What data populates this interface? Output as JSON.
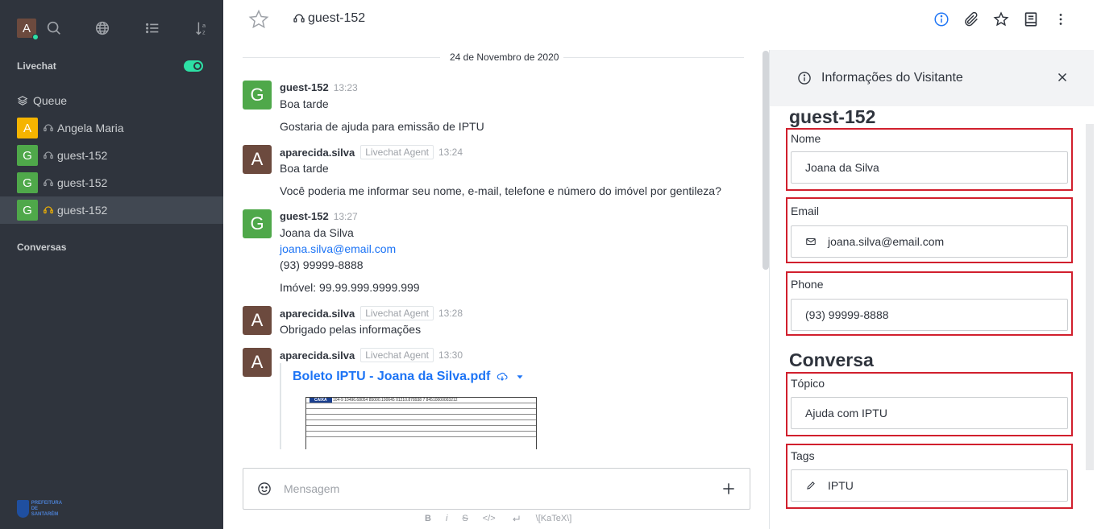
{
  "sidebar": {
    "user_initial": "A",
    "livechat_label": "Livechat",
    "queue_label": "Queue",
    "rooms": [
      {
        "initial": "A",
        "name": "Angela Maria",
        "color": "#f5b400",
        "active": false
      },
      {
        "initial": "G",
        "name": "guest-152",
        "color": "#4fa84a",
        "active": false
      },
      {
        "initial": "G",
        "name": "guest-152",
        "color": "#4fa84a",
        "active": false
      },
      {
        "initial": "G",
        "name": "guest-152",
        "color": "#4fa84a",
        "active": true
      }
    ],
    "conversas_label": "Conversas",
    "logo_text_line1": "PREFEITURA DE",
    "logo_text_line2": "SANTARÉM"
  },
  "header": {
    "room_name": "guest-152"
  },
  "messages": {
    "date": "24 de Novembro de 2020",
    "items": [
      {
        "initial": "G",
        "color": "#4fa84a",
        "user": "guest-152",
        "role": "",
        "time": "13:23",
        "lines": [
          "Boa tarde",
          "Gostaria de ajuda para emissão de IPTU"
        ]
      },
      {
        "initial": "A",
        "color": "#6c4a3e",
        "user": "aparecida.silva",
        "role": "Livechat Agent",
        "time": "13:24",
        "lines": [
          "Boa tarde",
          "Você poderia me informar seu nome, e-mail, telefone e número do imóvel por gentileza?"
        ]
      },
      {
        "initial": "G",
        "color": "#4fa84a",
        "user": "guest-152",
        "role": "",
        "time": "13:27",
        "lines": [
          "Joana da Silva",
          "joana.silva@email.com",
          "(93) 99999-8888",
          "Imóvel: 99.99.999.9999.999"
        ]
      },
      {
        "initial": "A",
        "color": "#6c4a3e",
        "user": "aparecida.silva",
        "role": "Livechat Agent",
        "time": "13:28",
        "lines": [
          "Obrigado pelas informações"
        ]
      },
      {
        "initial": "A",
        "color": "#6c4a3e",
        "user": "aparecida.silva",
        "role": "Livechat Agent",
        "time": "13:30",
        "lines": []
      }
    ],
    "attachment": {
      "title": "Boleto IPTU - Joana da Silva.pdf",
      "barcode": "104-9   10496.68054 85000.100645 01210.878938 7 84510000003212",
      "brand": "CAIXA"
    }
  },
  "composer": {
    "placeholder": "Mensagem",
    "format": {
      "bold": "B",
      "italic": "i",
      "strike": "S",
      "code": "</>",
      "katex": "\\[KaTeX\\]"
    }
  },
  "visitor_panel": {
    "title": "Informações do Visitante",
    "visitor_name": "guest-152",
    "fields": {
      "nome_label": "Nome",
      "nome_value": "Joana da Silva",
      "email_label": "Email",
      "email_value": "joana.silva@email.com",
      "phone_label": "Phone",
      "phone_value": "(93) 99999-8888"
    },
    "conversa_heading": "Conversa",
    "conversa": {
      "topico_label": "Tópico",
      "topico_value": "Ajuda com IPTU",
      "tags_label": "Tags",
      "tags_value": "IPTU"
    }
  }
}
